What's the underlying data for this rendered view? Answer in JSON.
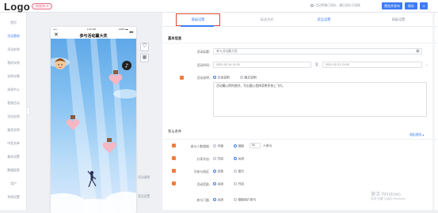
{
  "header": {
    "logo": "Logo",
    "status_badge": "待发布 ✕",
    "hint": "活动草稿已保存，最后保存于刚刚",
    "preview_label": "预览并发布",
    "save_label": "保存",
    "more_label": "⊙"
  },
  "sidebar": {
    "items": [
      {
        "label": "首页",
        "active": false
      },
      {
        "label": "活动营销",
        "active": true
      },
      {
        "label": "活动实例",
        "active": false
      },
      {
        "label": "我的实例",
        "active": false
      },
      {
        "label": "实例详情",
        "active": false
      },
      {
        "label": "消息中心",
        "active": false
      },
      {
        "label": "营销活动",
        "active": false
      },
      {
        "label": "活动实例",
        "active": false
      },
      {
        "label": "抽奖实例",
        "active": false
      },
      {
        "label": "中奖名单",
        "active": false
      },
      {
        "label": "基本设置",
        "active": false
      },
      {
        "label": "数据报表",
        "active": false
      },
      {
        "label": "用户",
        "active": false
      },
      {
        "label": "系统设置",
        "active": false
      }
    ]
  },
  "phone": {
    "status_left": "••••• ",
    "status_time": "1:21 AM",
    "status_right": "100% ▬",
    "title": "参与活动赢大奖",
    "close": "✕",
    "more": "•••",
    "music_icon": "♪",
    "labels": [
      "活动说明",
      "奖品设置"
    ]
  },
  "tools": [
    "⛉",
    "▦"
  ],
  "tabs": [
    {
      "label": "基础设置",
      "active": true
    },
    {
      "label": "玩法方式",
      "active": false
    },
    {
      "label": "奖品设置",
      "active": false
    },
    {
      "label": "高级设置",
      "active": false
    }
  ],
  "form": {
    "section_basic": "基本信息",
    "name_label": "活动标题:",
    "name_value": "参与活动赢大奖",
    "time_label": "活动时间:",
    "time_start": "2022-02-14 11:00",
    "time_sep": "至",
    "time_end": "2022-02-21 11:00",
    "desc_label": "活动说明:",
    "desc_opt1": "文本说明",
    "desc_opt2": "图文说明",
    "desc_text": "活动最心得的很好，写出要心投掉奖希多快上飞行。",
    "section_rules": "参与条件",
    "expand_link": "收起规则 ▴",
    "r1_label": "参与人数限制:",
    "r1_opt1": "不限",
    "r1_opt2": "限制",
    "r1_value": "50",
    "r1_unit": "人参与",
    "r2_label": "分享开启:",
    "r2_opt1": "开启",
    "r2_opt2": "关闭",
    "r3_label": "可参与地区:",
    "r3_opt1": "全部",
    "r3_opt2": "部分",
    "r4_label": "活动奖励:",
    "r4_opt1": "关闭",
    "r4_opt2": "开启",
    "r5_label": "参与门槛:",
    "r5_opt1": "关闭",
    "r5_opt2": "限制用户参与"
  },
  "watermark": {
    "line1": "激活 Windows",
    "line2": "转到\"设置\"以激活 Windows。"
  },
  "colors": {
    "accent": "#3d7cf2",
    "highlight_box": "#e04a2f",
    "marker": "#f07c3c",
    "badge": "#e7718a"
  }
}
